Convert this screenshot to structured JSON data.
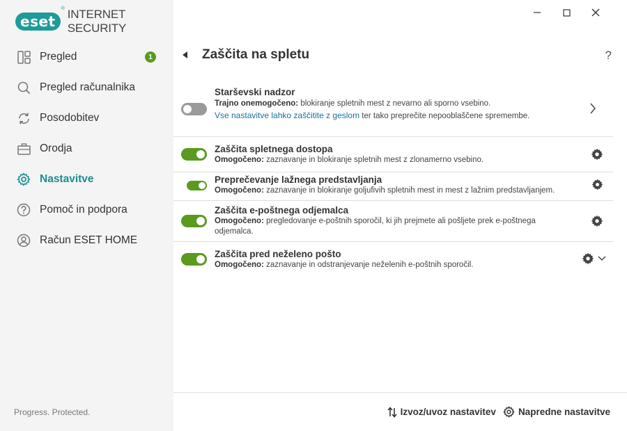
{
  "app": {
    "logo_badge": "eset",
    "logo_reg": "®",
    "product_name": "INTERNET SECURITY",
    "tagline": "Progress. Protected."
  },
  "window_controls": {
    "minimize": "—",
    "maximize": "☐",
    "close": "✕"
  },
  "sidebar": {
    "items": [
      {
        "label": "Pregled",
        "icon": "dashboard-icon",
        "badge": "1"
      },
      {
        "label": "Pregled računalnika",
        "icon": "magnifier-icon"
      },
      {
        "label": "Posodobitev",
        "icon": "refresh-icon"
      },
      {
        "label": "Orodja",
        "icon": "briefcase-icon"
      },
      {
        "label": "Nastavitve",
        "icon": "gear-icon",
        "active": true
      },
      {
        "label": "Pomoč in podpora",
        "icon": "question-icon"
      },
      {
        "label": "Račun ESET HOME",
        "icon": "account-icon"
      }
    ]
  },
  "main": {
    "title": "Zaščita na spletu",
    "help": "?",
    "rows": [
      {
        "title": "Starševski nadzor",
        "status": "Trajno onemogočeno:",
        "desc": " blokiranje spletnih mest z nevarno ali sporno vsebino.",
        "link": "Vse nastavitve lahko zaščitite z geslom",
        "link_after": " ter tako preprečite nepooblaščene spremembe.",
        "enabled": false
      },
      {
        "title": "Zaščita spletnega dostopa",
        "status": "Omogočeno:",
        "desc": " zaznavanje in blokiranje spletnih mest z zlonamerno vsebino.",
        "enabled": true
      },
      {
        "title": "Preprečevanje lažnega predstavljanja",
        "status": "Omogočeno:",
        "desc": " zaznavanje in blokiranje goljufivih spletnih mest in mest z lažnim predstavljanjem.",
        "enabled": true
      },
      {
        "title": "Zaščita e-poštnega odjemalca",
        "status": "Omogočeno:",
        "desc": " pregledovanje e-poštnih sporočil, ki jih prejmete ali pošljete prek e-poštnega odjemalca.",
        "enabled": true
      },
      {
        "title": "Zaščita pred neželeno pošto",
        "status": "Omogočeno:",
        "desc": " zaznavanje in odstranjevanje neželenih e-poštnih sporočil.",
        "enabled": true
      }
    ]
  },
  "footer": {
    "import_export": "Izvoz/uvoz nastavitev",
    "advanced": "Napredne nastavitve"
  },
  "colors": {
    "accent": "#1d8d91",
    "toggle_on": "#5a9a1f",
    "toggle_off": "#9a9a9a",
    "link": "#1a6f9f"
  }
}
